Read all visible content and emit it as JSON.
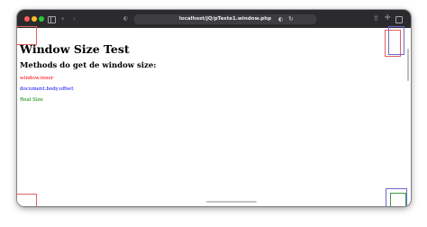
{
  "browser": {
    "address": "localhost/jQ/pTeste1.window.php"
  },
  "page": {
    "title": "Window Size Test",
    "subtitle": "Methods do get de window size:",
    "methods": [
      {
        "label": "window.inner",
        "color": "#ff0000"
      },
      {
        "label": "document.body.offset",
        "color": "#0000ff"
      },
      {
        "label": "Real Size",
        "color": "#008000"
      }
    ]
  },
  "colors": {
    "close": "#ff5f57",
    "minimize": "#febc2e",
    "zoom": "#28c840",
    "toolbar": "#2b2b2e",
    "marker_red": "#e06060",
    "marker_blue": "#6a6acf",
    "marker_green": "#3f9a3f"
  }
}
